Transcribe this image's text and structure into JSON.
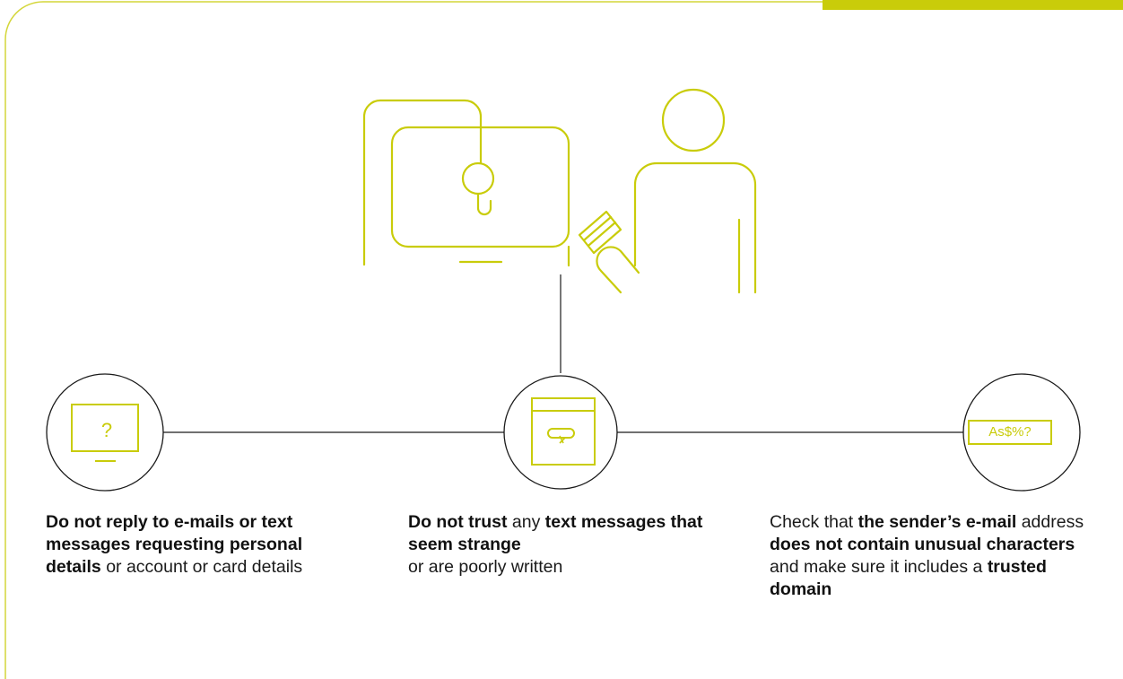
{
  "colors": {
    "accent": "#c9cc0a",
    "line": "#1a1a1a",
    "frame": "#d4d63a"
  },
  "icons": {
    "illustration": "person-inserting-card-at-atm-icon",
    "tip_1": "monitor-question-icon",
    "tip_2": "document-link-icon",
    "tip_3": "unusual-characters-badge-icon"
  },
  "tips": [
    {
      "segments": [
        {
          "text": "Do not reply to e-mails or text messages requesting personal details",
          "bold": true
        },
        {
          "text": " or account or card details",
          "bold": false
        }
      ],
      "icon_text": "?"
    },
    {
      "segments": [
        {
          "text": "Do not trust",
          "bold": true
        },
        {
          "text": " any ",
          "bold": false
        },
        {
          "text": "text messages that seem strange",
          "bold": true
        },
        {
          "text": " or are poorly written",
          "bold": false
        }
      ]
    },
    {
      "segments": [
        {
          "text": "Check that ",
          "bold": false
        },
        {
          "text": "the sender’s e-mail",
          "bold": true
        },
        {
          "text": " address ",
          "bold": false
        },
        {
          "text": "does not contain unusual characters",
          "bold": true
        },
        {
          "text": " and make sure it includes a ",
          "bold": false
        },
        {
          "text": "trusted domain",
          "bold": true
        }
      ],
      "icon_text": "As$%?"
    }
  ]
}
